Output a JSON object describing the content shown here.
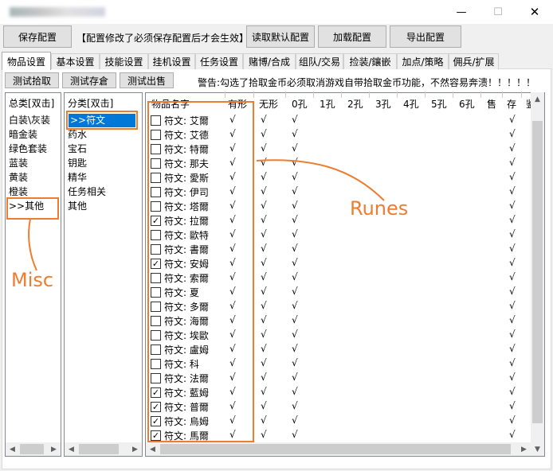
{
  "toolbar": {
    "save": "保存配置",
    "notice": "【配置修改了必须保存配置后才会生效】",
    "load_default": "读取默认配置",
    "load": "加载配置",
    "export": "导出配置"
  },
  "tabs": [
    "物品设置",
    "基本设置",
    "技能设置",
    "挂机设置",
    "任务设置",
    "赌博/合成",
    "组队/交易",
    "捡装/鑲嵌",
    "加点/策略",
    "佣兵/扩展"
  ],
  "actions": {
    "test_pickup": "测试拾取",
    "test_stash": "测试存倉",
    "test_sell": "测试出售",
    "warning": "警告:勾选了拾取金币必须取消游戏自带拾取金币功能，不然容易奔溃！！！！！"
  },
  "total_list": {
    "header": "总类[双击]",
    "items": [
      "白装\\灰装",
      "暗金装",
      "绿色套装",
      "蓝装",
      "黄装",
      "橙装",
      ">>其他"
    ]
  },
  "category_list": {
    "header": "分类[双击]",
    "items": [
      ">>符文",
      "药水",
      "宝石",
      "钥匙",
      "精华",
      "任务相关",
      "其他"
    ]
  },
  "grid": {
    "columns": [
      "物品名字",
      "有形",
      "无形",
      "0孔",
      "1孔",
      "2孔",
      "3孔",
      "4孔",
      "5孔",
      "6孔",
      "售",
      "存",
      "鉴"
    ],
    "check_glyph": "√",
    "checkbox_checked_glyph": "✓",
    "rows": [
      {
        "name": "符文: 艾爾",
        "checked": false
      },
      {
        "name": "符文: 艾德",
        "checked": false
      },
      {
        "name": "符文: 特爾",
        "checked": false
      },
      {
        "name": "符文: 那夫",
        "checked": false
      },
      {
        "name": "符文: 愛斯",
        "checked": false
      },
      {
        "name": "符文: 伊司",
        "checked": false
      },
      {
        "name": "符文: 塔爾",
        "checked": false
      },
      {
        "name": "符文: 拉爾",
        "checked": true
      },
      {
        "name": "符文: 歐特",
        "checked": false
      },
      {
        "name": "符文: 書爾",
        "checked": false
      },
      {
        "name": "符文: 安姆",
        "checked": true
      },
      {
        "name": "符文: 索爾",
        "checked": false
      },
      {
        "name": "符文: 夏",
        "checked": false
      },
      {
        "name": "符文: 多爾",
        "checked": false
      },
      {
        "name": "符文: 海爾",
        "checked": false
      },
      {
        "name": "符文: 埃歐",
        "checked": false
      },
      {
        "name": "符文: 盧姆",
        "checked": false
      },
      {
        "name": "符文: 科",
        "checked": false
      },
      {
        "name": "符文: 法爾",
        "checked": false
      },
      {
        "name": "符文: 藍姆",
        "checked": true
      },
      {
        "name": "符文: 普爾",
        "checked": true
      },
      {
        "name": "符文: 烏姆",
        "checked": true
      },
      {
        "name": "符文: 馬爾",
        "checked": true
      }
    ]
  },
  "annotations": {
    "runes": "Runes",
    "misc": "Misc",
    "color": "#ed7d31"
  },
  "window": {
    "minimize_glyph": "—",
    "maximize_glyph": "☐",
    "close_glyph": "✕",
    "scroll_left": "◀",
    "scroll_right": "▶",
    "scroll_up": "▲",
    "scroll_down": "▼"
  }
}
